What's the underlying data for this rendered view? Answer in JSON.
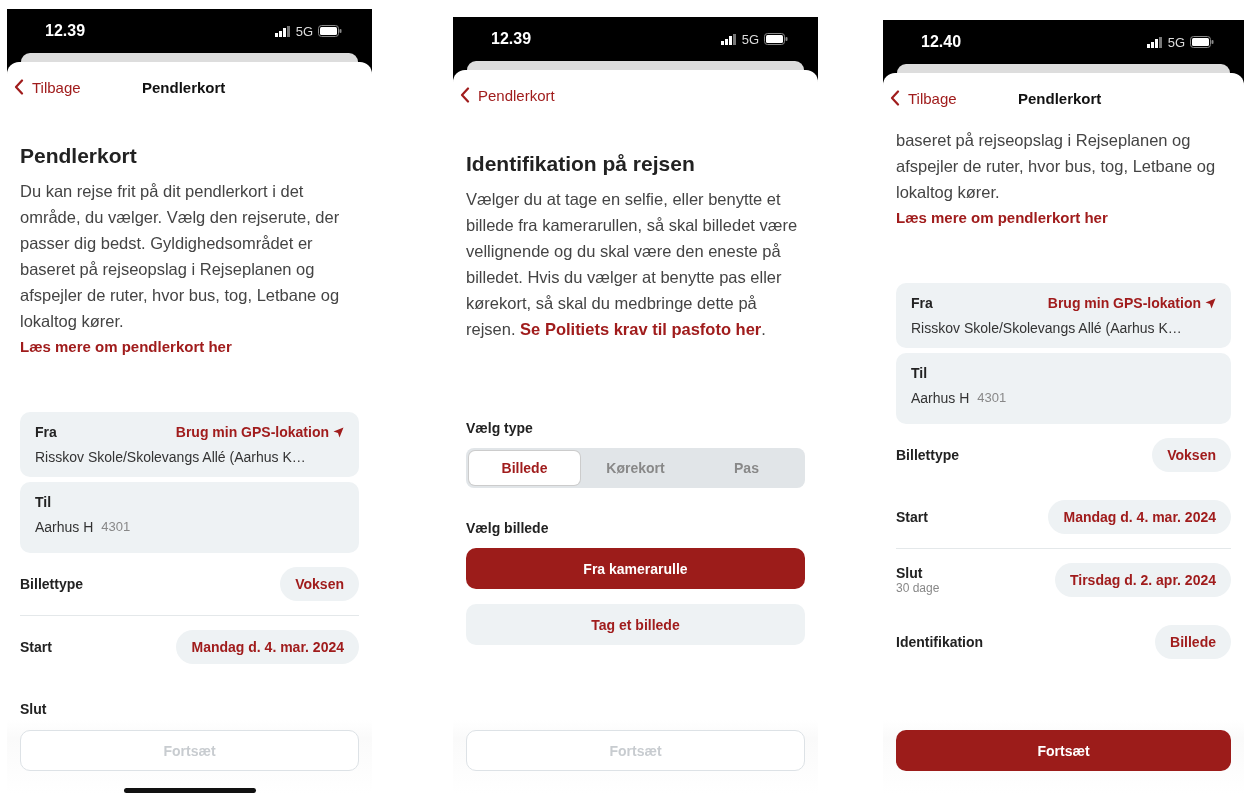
{
  "screens": [
    {
      "status_bar": {
        "time": "12.39",
        "network": "5G"
      },
      "nav": {
        "back_label": "Tilbage",
        "title": "Pendlerkort"
      },
      "blocks": [
        {
          "kind": "heading",
          "text": "Pendlerkort"
        },
        {
          "kind": "paragraph",
          "text": "Du kan rejse frit på dit pendlerkort i det område, du vælger. Vælg den rejserute, der passer dig bedst. Gyldighedsområdet er baseret på rejseopslag i Rejseplanen og afspejler de ruter, hvor bus, tog, Letbane og lokaltog kører."
        },
        {
          "kind": "link",
          "text": "Læs mere om pendlerkort her"
        },
        {
          "kind": "route",
          "from_label": "Fra",
          "gps_label": "Brug min GPS-lokation",
          "from_value": "Risskov Skole/Skolevangs Allé (Aarhus K…",
          "to_label": "Til",
          "to_value": "Aarhus H",
          "to_code": "4301"
        },
        {
          "kind": "row",
          "label": "Billettype",
          "value": "Voksen"
        },
        {
          "kind": "divider"
        },
        {
          "kind": "row",
          "label": "Start",
          "value": "Mandag d. 4. mar. 2024"
        },
        {
          "kind": "row",
          "label": "Slut"
        }
      ],
      "footer_button": {
        "label": "Fortsæt",
        "disabled": true
      }
    },
    {
      "status_bar": {
        "time": "12.39",
        "network": "5G"
      },
      "nav": {
        "back_label": "Pendlerkort"
      },
      "blocks": [
        {
          "kind": "heading",
          "text": "Identifikation på rejsen"
        },
        {
          "kind": "paragraph",
          "text": "Vælger du at tage en selfie, eller benytte et billede fra kamerarullen, så skal billedet være vellignende og du skal være den eneste på billedet. Hvis du vælger at benytte pas eller kørekort, så skal du medbringe dette på rejsen. ",
          "link": "Se Politiets krav til pasfoto her",
          "tail": "."
        },
        {
          "kind": "label",
          "text": "Vælg type"
        },
        {
          "kind": "segmented",
          "options": [
            {
              "label": "Billede",
              "selected": true
            },
            {
              "label": "Kørekort",
              "selected": false
            },
            {
              "label": "Pas",
              "selected": false
            }
          ]
        },
        {
          "kind": "label",
          "text": "Vælg billede"
        },
        {
          "kind": "primary_button",
          "label": "Fra kamerarulle"
        },
        {
          "kind": "secondary_button",
          "label": "Tag et billede"
        }
      ],
      "footer_button": {
        "label": "Fortsæt",
        "disabled": true
      }
    },
    {
      "status_bar": {
        "time": "12.40",
        "network": "5G"
      },
      "nav": {
        "back_label": "Tilbage",
        "title": "Pendlerkort"
      },
      "blocks": [
        {
          "kind": "paragraph",
          "text": "baseret på rejseopslag i Rejseplanen og afspejler de ruter, hvor bus, tog, Letbane og lokaltog kører."
        },
        {
          "kind": "link",
          "text": "Læs mere om pendlerkort her"
        },
        {
          "kind": "route",
          "from_label": "Fra",
          "gps_label": "Brug min GPS-lokation",
          "from_value": "Risskov Skole/Skolevangs Allé (Aarhus K…",
          "to_label": "Til",
          "to_value": "Aarhus H",
          "to_code": "4301"
        },
        {
          "kind": "row",
          "label": "Billettype",
          "value": "Voksen"
        },
        {
          "kind": "row",
          "label": "Start",
          "value": "Mandag d. 4. mar. 2024"
        },
        {
          "kind": "divider"
        },
        {
          "kind": "row",
          "label": "Slut",
          "sublabel": "30 dage",
          "value": "Tirsdag d. 2. apr. 2024"
        },
        {
          "kind": "row",
          "label": "Identifikation",
          "value": "Billede"
        }
      ],
      "footer_button": {
        "label": "Fortsæt",
        "disabled": false
      }
    }
  ]
}
